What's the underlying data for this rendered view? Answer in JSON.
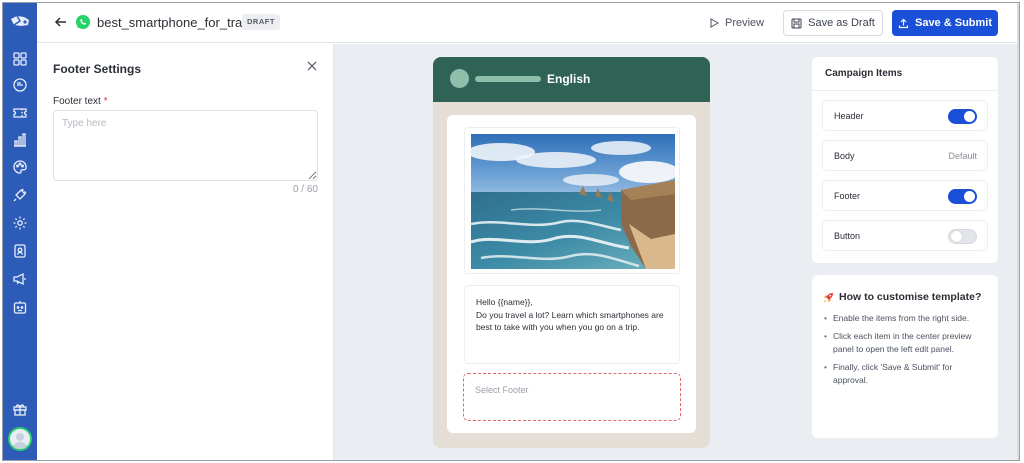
{
  "header": {
    "template_name": "best_smartphone_for_travel",
    "status_badge": "DRAFT",
    "preview_label": "Preview",
    "save_draft_label": "Save as Draft",
    "save_submit_label": "Save & Submit"
  },
  "sidebar": {
    "items": [
      {
        "icon": "dashboard-grid-icon"
      },
      {
        "icon": "chat-bubble-icon"
      },
      {
        "icon": "ticket-icon"
      },
      {
        "icon": "analytics-bar-icon"
      },
      {
        "icon": "palette-icon"
      },
      {
        "icon": "plug-icon"
      },
      {
        "icon": "settings-gear-icon"
      },
      {
        "icon": "contacts-book-icon"
      },
      {
        "icon": "campaign-megaphone-icon"
      },
      {
        "icon": "bot-icon"
      }
    ],
    "bottom": {
      "icon": "gift-icon"
    }
  },
  "left_panel": {
    "title": "Footer Settings",
    "field_label": "Footer text",
    "required_mark": "*",
    "placeholder": "Type here",
    "value": "",
    "char_count": "0 / 60"
  },
  "preview": {
    "language": "English",
    "body_lines": [
      "Hello {{name}},",
      "Do you travel a lot? Learn which smartphones are best to take with you when you go on a trip."
    ],
    "footer_placeholder": "Select Footer"
  },
  "campaign_items": {
    "title": "Campaign Items",
    "rows": [
      {
        "label": "Header",
        "state": "on"
      },
      {
        "label": "Body",
        "state": "Default"
      },
      {
        "label": "Footer",
        "state": "on"
      },
      {
        "label": "Button",
        "state": "off"
      }
    ]
  },
  "howto": {
    "title": "How to customise template?",
    "steps": [
      "Enable the items from the right side.",
      "Click each item in the center preview panel to open the left edit panel.",
      "Finally, click 'Save & Submit' for approval."
    ]
  },
  "colors": {
    "sidebar": "#2c5cb8",
    "primary": "#1a4fd8",
    "whatsapp_header": "#2e6356",
    "chat_bg": "#e5ded6",
    "footer_dashed_border": "#e06767",
    "required": "#e0383e"
  }
}
